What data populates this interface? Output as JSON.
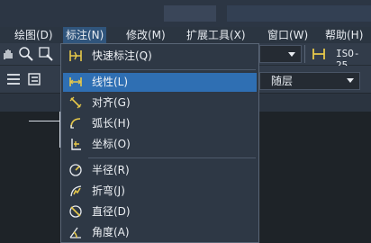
{
  "titlebar": {},
  "menubar": {
    "items": [
      {
        "label": "绘图(D)"
      },
      {
        "label": "标注(N)"
      },
      {
        "label": "修改(M)"
      },
      {
        "label": "扩展工具(X)"
      },
      {
        "label": "窗口(W)"
      },
      {
        "label": "帮助(H)"
      }
    ]
  },
  "toolbar": {
    "dimstyle_value": "ISO-25",
    "layer_value": "随层"
  },
  "menu": {
    "items": [
      {
        "label": "快速标注(Q)"
      },
      {
        "label": "线性(L)"
      },
      {
        "label": "对齐(G)"
      },
      {
        "label": "弧长(H)"
      },
      {
        "label": "坐标(O)"
      },
      {
        "label": "半径(R)"
      },
      {
        "label": "折弯(J)"
      },
      {
        "label": "直径(D)"
      },
      {
        "label": "角度(A)"
      }
    ]
  },
  "colors": {
    "highlight": "#2f6fb3",
    "menu_bg": "#2e3845",
    "active_menubar": "#30557c",
    "icon_yellow": "#e6c84a"
  }
}
